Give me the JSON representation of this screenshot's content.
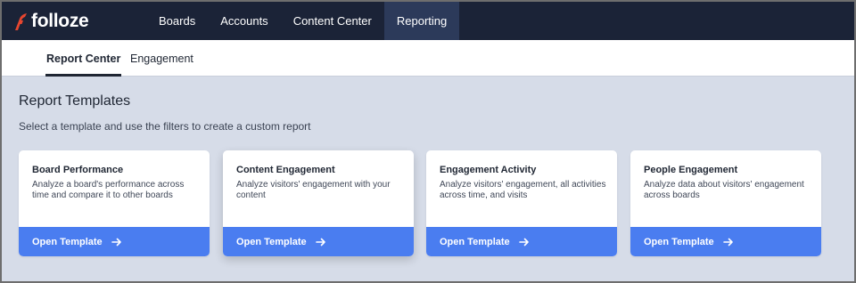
{
  "brand": {
    "name": "folloze"
  },
  "topnav": {
    "items": [
      {
        "label": "Boards",
        "active": false
      },
      {
        "label": "Accounts",
        "active": false
      },
      {
        "label": "Content Center",
        "active": false
      },
      {
        "label": "Reporting",
        "active": true
      }
    ]
  },
  "subnav": {
    "tabs": [
      {
        "label": "Report Center",
        "active": true
      },
      {
        "label": "Engagement",
        "active": false
      }
    ]
  },
  "main": {
    "title": "Report Templates",
    "subtitle": "Select a template and use the filters to create a custom report",
    "cards": [
      {
        "title": "Board Performance",
        "description": "Analyze a board's performance across time and compare it to other boards",
        "button": "Open Template"
      },
      {
        "title": "Content Engagement",
        "description": "Analyze visitors' engagement with your content",
        "button": "Open Template"
      },
      {
        "title": "Engagement Activity",
        "description": "Analyze visitors' engagement, all activities across time, and visits",
        "button": "Open Template"
      },
      {
        "title": "People Engagement",
        "description": "Analyze data about visitors' engagement across boards",
        "button": "Open Template"
      }
    ]
  },
  "colors": {
    "topbar": "#1b2337",
    "active_nav": "#2c3a5a",
    "accent": "#4a7df0",
    "logo_mark": "#e8462f",
    "page_bg": "#d6dce8"
  },
  "icons": {
    "logo": "folloze-mark-icon",
    "card_button": "arrow-right-icon"
  }
}
